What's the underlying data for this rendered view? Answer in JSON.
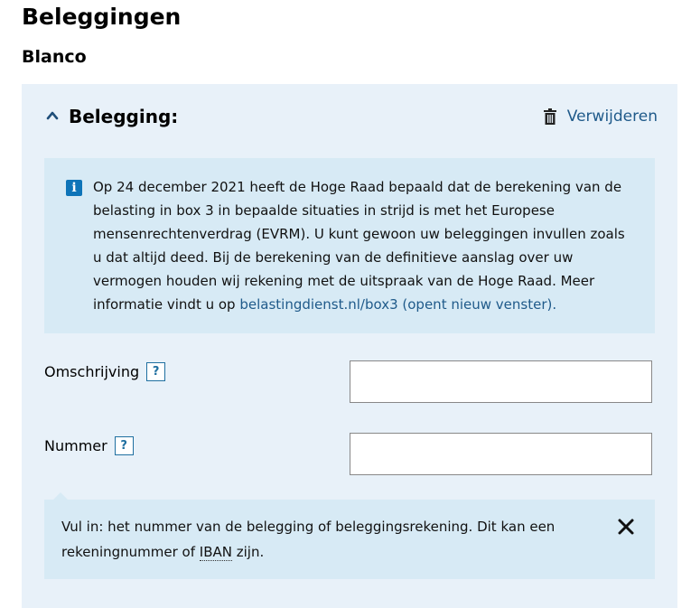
{
  "page": {
    "title": "Beleggingen",
    "section": "Blanco"
  },
  "panel": {
    "title": "Belegging:",
    "delete_label": "Verwijderen",
    "info": {
      "text": "Op 24 december 2021 heeft de Hoge Raad bepaald dat de berekening van de belasting in box 3 in bepaalde situaties in strijd is met het Europese mensenrechtenverdrag (EVRM). U kunt gewoon uw beleggingen invullen zoals u dat altijd deed. Bij de berekening van de definitieve aanslag over uw vermogen houden wij rekening met de uitspraak van de Hoge Raad. Meer informatie vindt u op ",
      "link": "belastingdienst.nl/box3 (opent nieuw venster).",
      "icon": "info-icon"
    },
    "fields": {
      "omschrijving": {
        "label": "Omschrijving",
        "help": "?",
        "value": ""
      },
      "nummer": {
        "label": "Nummer",
        "help": "?",
        "value": ""
      }
    },
    "tooltip": {
      "text_before": "Vul in: het nummer van de belegging of beleggingsrekening. Dit kan een rekeningnummer of ",
      "abbr": "IBAN",
      "text_after": " zijn.",
      "close_icon": "close-icon"
    }
  },
  "colors": {
    "panel_bg": "#e8f1f9",
    "info_bg": "#d7eaf5",
    "link": "#1f5a8a",
    "info_icon": "#0e74b8"
  }
}
